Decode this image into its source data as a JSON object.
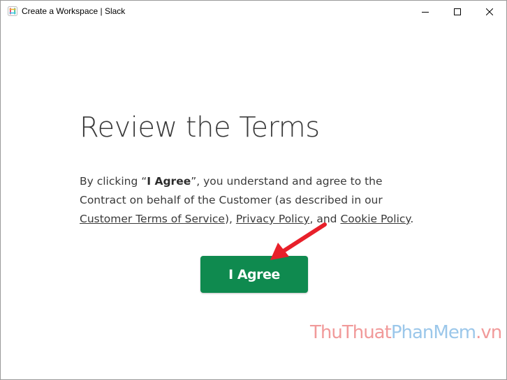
{
  "window": {
    "title": "Create a Workspace | Slack",
    "app_icon": "slack-app-icon",
    "controls": {
      "minimize": "minimize-icon",
      "maximize": "maximize-icon",
      "close": "close-icon"
    }
  },
  "main": {
    "heading": "Review the Terms",
    "terms": {
      "p1": "By clicking “",
      "bold": "I Agree",
      "p2": "”, you understand and agree to the Contract on behalf of the Customer (as described in our ",
      "link_customer_terms": "Customer Terms of Service",
      "p3": "), ",
      "link_privacy": "Privacy Policy",
      "p4": ", and ",
      "link_cookie": "Cookie Policy",
      "p5": "."
    },
    "agree_button": "I Agree"
  },
  "watermark": {
    "part1": "ThuThuat",
    "part2": "PhanMem",
    "part3": ".vn"
  },
  "colors": {
    "accent_button": "#0f8a4f",
    "annotation_arrow": "#e8202a",
    "body_text": "#3a3a3a"
  }
}
